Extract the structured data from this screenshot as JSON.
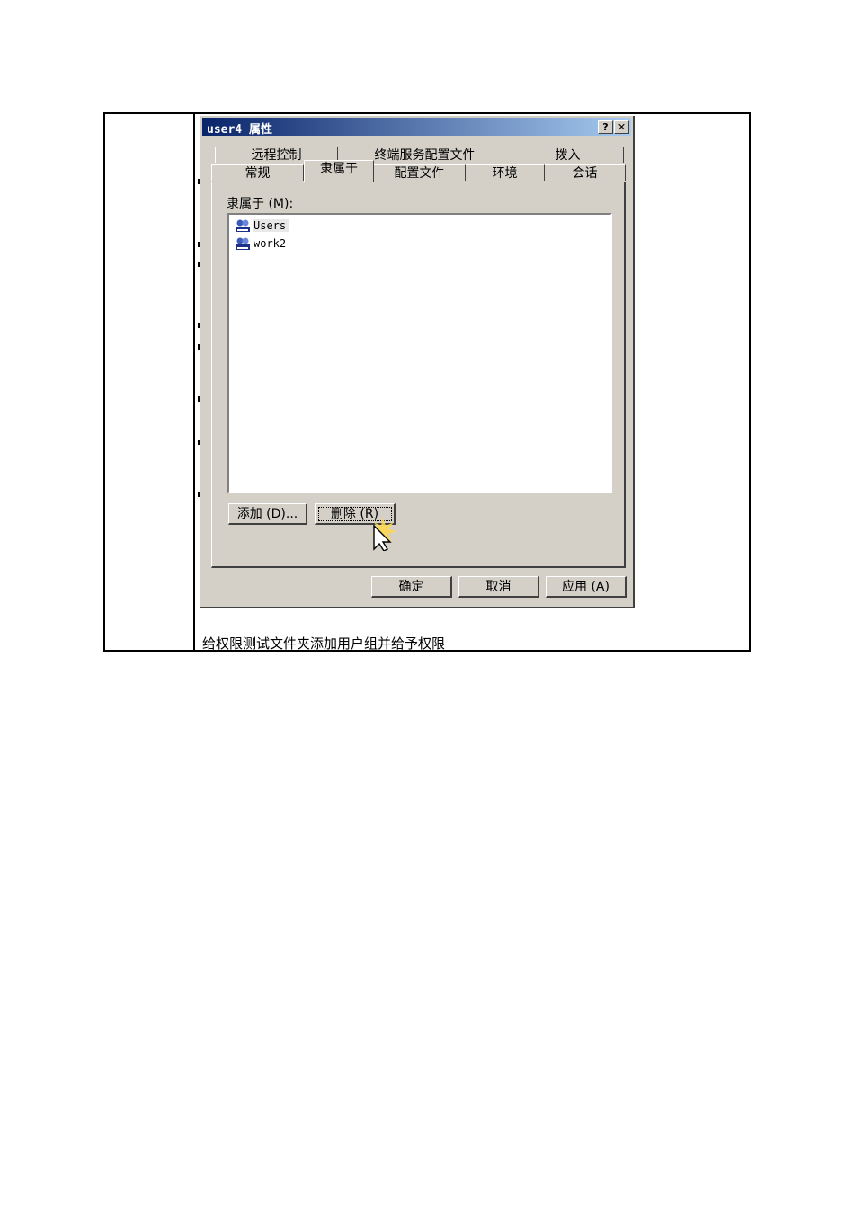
{
  "dialog": {
    "title": "user4 属性",
    "help_button": "?",
    "close_button": "✕",
    "tabs_back_row": [
      "远程控制",
      "终端服务配置文件",
      "拨入"
    ],
    "tabs_front_row": [
      "常规",
      "隶属于",
      "配置文件",
      "环境",
      "会话"
    ],
    "active_tab": "隶属于",
    "member_of_label": "隶属于 (M):",
    "members": [
      "Users",
      "work2"
    ],
    "add_button": "添加 (D)...",
    "remove_button": "删除 (R)",
    "ok_button": "确定",
    "cancel_button": "取消",
    "apply_button": "应用 (A)"
  },
  "caption": "给权限测试文件夹添加用户组并给予权限",
  "colors": {
    "titlebar_start": "#0a246a",
    "titlebar_end": "#a6caf0",
    "face": "#d4d0c8"
  }
}
